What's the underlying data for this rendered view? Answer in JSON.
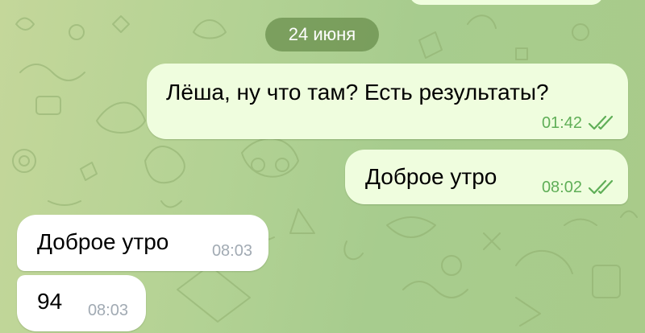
{
  "date_separator": "24 июня",
  "messages": [
    {
      "text": "Лёша, ну что там? Есть результаты?",
      "time": "01:42",
      "direction": "outgoing",
      "status": "read"
    },
    {
      "text": "Доброе утро",
      "time": "08:02",
      "direction": "outgoing",
      "status": "read"
    },
    {
      "text": "Доброе утро",
      "time": "08:03",
      "direction": "incoming"
    },
    {
      "text": "94",
      "time": "08:03",
      "direction": "incoming"
    }
  ],
  "colors": {
    "outgoing_bubble": "#effdde",
    "incoming_bubble": "#ffffff",
    "outgoing_time": "#5fae57",
    "incoming_time": "#a1aab3",
    "date_pill": "#678c4a"
  },
  "icons": {
    "read_receipt": "double-check-icon",
    "wallpaper": "doodle-pattern"
  }
}
